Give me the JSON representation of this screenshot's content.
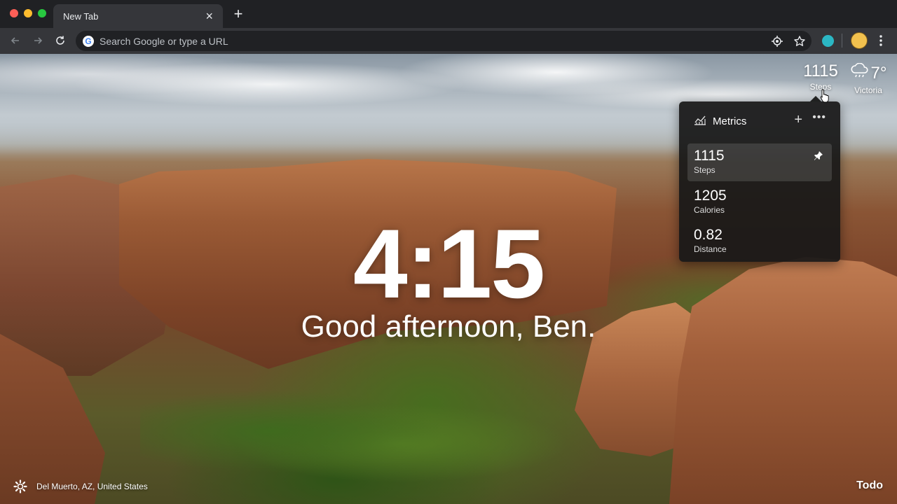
{
  "browser": {
    "tab": {
      "title": "New Tab",
      "close_icon": "close-icon"
    },
    "new_tab_icon": "plus-icon",
    "omnibox": {
      "placeholder": "Search Google or type a URL"
    },
    "colors": {
      "tabstrip": "#202124",
      "toolbar": "#35363a",
      "omnibox": "#202124"
    }
  },
  "momentum": {
    "clock": "4:15",
    "greeting": "Good afternoon, Ben.",
    "steps": {
      "value": "1115",
      "label": "Steps"
    },
    "weather": {
      "temp": "7°",
      "location": "Victoria",
      "icon": "rain-cloud-icon"
    },
    "metrics_panel": {
      "title": "Metrics",
      "items": [
        {
          "value": "1115",
          "label": "Steps",
          "pinned": true
        },
        {
          "value": "1205",
          "label": "Calories"
        },
        {
          "value": "0.82",
          "label": "Distance"
        }
      ]
    },
    "location_caption": "Del Muerto, AZ, United States",
    "todo_label": "Todo"
  }
}
